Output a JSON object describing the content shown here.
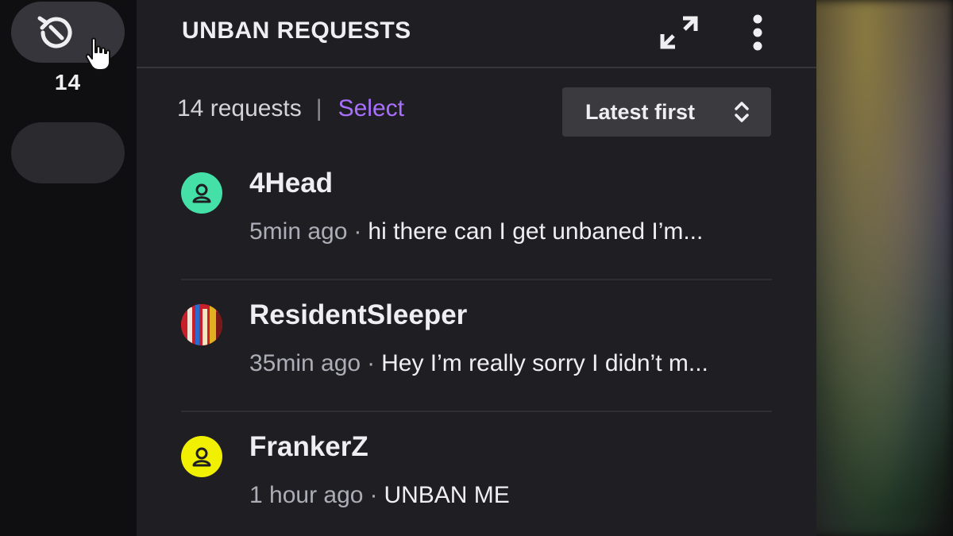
{
  "rail": {
    "count": "14"
  },
  "panel": {
    "title": "UNBAN REQUESTS",
    "summary": {
      "count_text": "14 requests",
      "separator": "|",
      "select_label": "Select"
    },
    "sort": {
      "label": "Latest first"
    }
  },
  "requests": [
    {
      "name": "4Head",
      "time": "5min ago",
      "separator": "·",
      "message": "hi there can I get unbaned I’m...",
      "avatar_color": "#45e0a8",
      "avatar_icon": "user-icon"
    },
    {
      "name": "ResidentSleeper",
      "time": "35min ago",
      "separator": "·",
      "message": "Hey I’m really sorry I didn’t m...",
      "avatar_color": "#c8202a",
      "avatar_icon": "photo-avatar"
    },
    {
      "name": "FrankerZ",
      "time": "1 hour ago",
      "separator": "·",
      "message": "UNBAN ME",
      "avatar_color": "#f0f000",
      "avatar_icon": "user-icon"
    }
  ],
  "colors": {
    "accent": "#a970ff",
    "panel_bg": "#1f1f23",
    "rail_bg": "#0f0f11"
  }
}
